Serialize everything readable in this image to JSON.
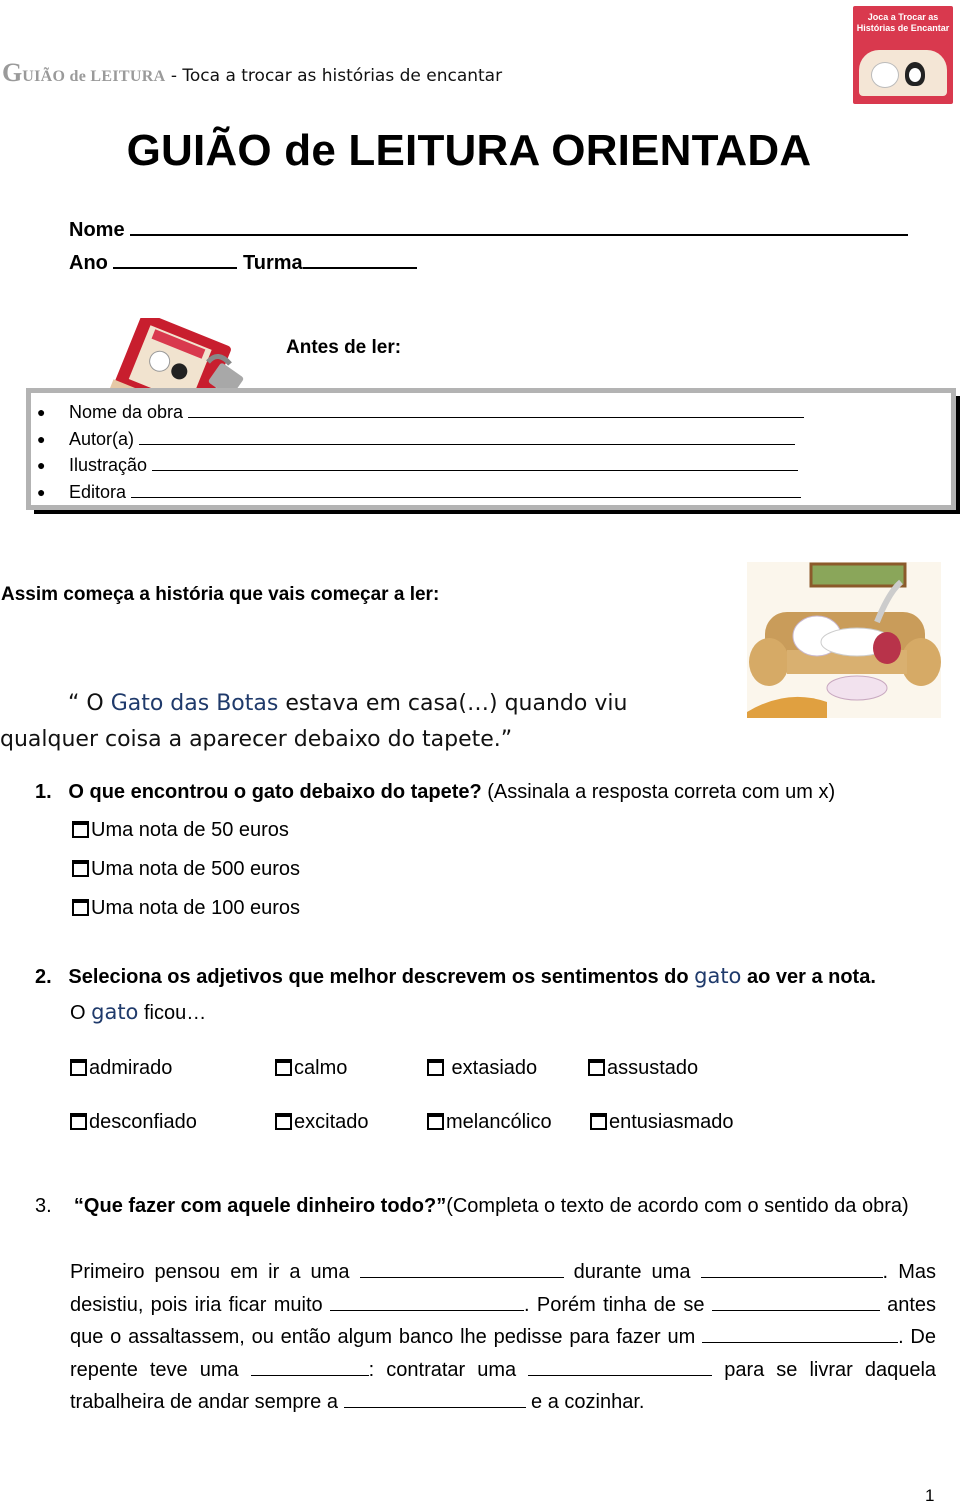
{
  "header": {
    "guide_initial": "G",
    "guide_rest": "UIÃO de LEITURA",
    "separator": " - ",
    "book_title": "Toca a trocar as histórias de encantar"
  },
  "cover_thumbnail": {
    "title_line1": "Joca a Trocar as",
    "title_line2": "Histórias de Encantar"
  },
  "page_title": "GUIÃO de LEITURA ORIENTADA",
  "student_fields": {
    "name_label": "Nome",
    "year_label": "Ano",
    "class_label": "Turma"
  },
  "before_reading": {
    "heading": "Antes de ler:",
    "items": [
      {
        "label": "Nome da obra"
      },
      {
        "label": "Autor(a)"
      },
      {
        "label": "Ilustração"
      },
      {
        "label": "Editora"
      }
    ]
  },
  "intro": {
    "heading": "Assim começa a história que vais começar a ler:",
    "quote_open": "“ O ",
    "quote_highlight": "Gato das Botas",
    "quote_line1_rest": " estava em casa(…) quando viu",
    "quote_line2": "qualquer coisa a aparecer debaixo do tapete.”"
  },
  "question1": {
    "number": "1.",
    "text_bold": "O que encontrou o gato debaixo do tapete?",
    "text_note": " (Assinala a resposta correta com um x)",
    "options": [
      "Uma nota de 50 euros",
      "Uma nota de 500 euros",
      "Uma nota de 100 euros"
    ]
  },
  "question2": {
    "number": "2.",
    "text_before": "Seleciona os adjetivos que melhor descrevem os sentimentos do ",
    "highlight": "gato",
    "text_after": " ao ver a nota.",
    "sub_before": "O ",
    "sub_after": " ficou…",
    "options_row1": [
      "admirado",
      "calmo",
      " extasiado",
      "assustado"
    ],
    "options_row2": [
      "desconfiado",
      "excitado",
      "melancólico",
      "entusiasmado"
    ]
  },
  "question3": {
    "number": "3.",
    "text_bold": "“Que fazer com aquele dinheiro todo?”",
    "text_note": "(Completa o texto de acordo com o sentido da obra)",
    "p1": "Primeiro pensou em ir a uma ",
    "p2": " durante uma ",
    "p3": ". Mas desistiu, pois iria ficar muito ",
    "p4": ". Porém tinha de se ",
    "p5": " antes que o assaltassem, ou então algum banco lhe pedisse para fazer um ",
    "p6": ". De repente teve uma ",
    "p7": ": contratar uma ",
    "p8": " para se livrar daquela trabalheira de andar sempre a ",
    "p9": " e a cozinhar."
  },
  "page_number": "1"
}
